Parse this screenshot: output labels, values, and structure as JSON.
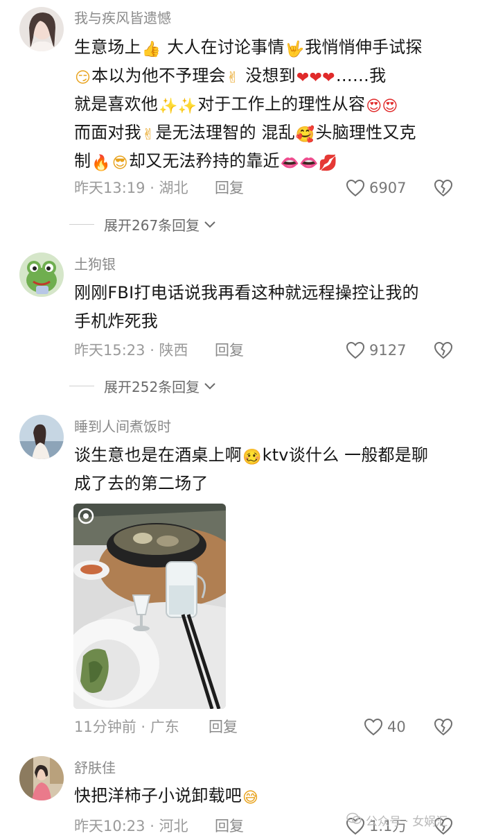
{
  "comments": [
    {
      "username": "我与疾风皆遗憾",
      "lines": [
        [
          {
            "t": "生意场上"
          },
          {
            "e": "👍"
          },
          {
            "t": " 大人在讨论事情"
          },
          {
            "e": "🤟"
          },
          {
            "t": "我悄悄伸手试探"
          }
        ],
        [
          {
            "e": "😏"
          },
          {
            "t": "本以为他不予理会"
          },
          {
            "e": "✌"
          },
          {
            "t": " 没想到"
          },
          {
            "e": "❤❤❤",
            "c": "red"
          },
          {
            "t": "……我"
          }
        ],
        [
          {
            "t": "就是喜欢他"
          },
          {
            "e": "✨✨",
            "c": "gold"
          },
          {
            "t": "对于工作上的理性从容"
          },
          {
            "e": "😍😍",
            "c": "red"
          }
        ],
        [
          {
            "t": "而面对我"
          },
          {
            "e": "✌"
          },
          {
            "t": "是无法理智的 混乱"
          },
          {
            "e": "🥰",
            "c": "red"
          },
          {
            "t": "头脑理性又克"
          }
        ],
        [
          {
            "t": "制"
          },
          {
            "e": "🔥",
            "c": "red"
          },
          {
            "e": "😎"
          },
          {
            "t": "却又无法矜持的靠近"
          },
          {
            "e": "👄👄💋",
            "c": "pink"
          }
        ]
      ],
      "time": "昨天13:19 · 湖北",
      "reply": "回复",
      "likes": "6907",
      "expand": "展开267条回复"
    },
    {
      "username": "土狗银",
      "lines": [
        [
          {
            "t": "刚刚FBI打电话说我再看这种就远程操控让我的"
          }
        ],
        [
          {
            "t": "手机炸死我"
          }
        ]
      ],
      "time": "昨天15:23 · 陕西",
      "reply": "回复",
      "likes": "9127",
      "expand": "展开252条回复"
    },
    {
      "username": "睡到人间煮饭时",
      "lines": [
        [
          {
            "t": "谈生意也是在酒桌上啊"
          },
          {
            "e": "🥴"
          },
          {
            "t": "ktv谈什么 一般都是聊"
          }
        ],
        [
          {
            "t": "成了去的第二场了"
          }
        ]
      ],
      "time": "11分钟前 · 广东",
      "reply": "回复",
      "likes": "40"
    },
    {
      "username": "舒肤佳",
      "lines": [
        [
          {
            "t": "快把洋柿子小说卸载吧"
          },
          {
            "e": "😅"
          }
        ]
      ],
      "time": "昨天10:23 · 河北",
      "reply": "回复",
      "likes": "1.1万"
    }
  ],
  "watermark": "公众号 · 女娲汇",
  "icons": {
    "like": "heart-outline-icon",
    "dislike": "broken-heart-icon",
    "expand": "chevron-down-icon",
    "photo_badge": "live-photo-icon"
  },
  "colors": {
    "text": "#161616",
    "meta": "#9a9a9a",
    "username": "#8a8a8a"
  }
}
